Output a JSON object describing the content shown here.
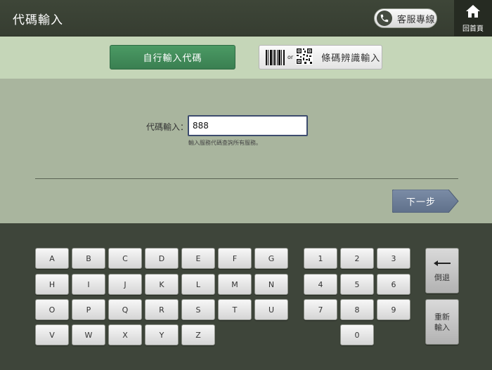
{
  "header": {
    "title": "代碼輸入",
    "hotline_label": "客服專線",
    "home_label": "回首頁"
  },
  "mode": {
    "manual_label": "自行輸入代碼",
    "or_text": "or",
    "scan_label": "條碼辨識輸入"
  },
  "form": {
    "code_label": "代碼輸入：",
    "code_value": "888",
    "hint": "輸入服務代碼查詢所有服務。",
    "next_label": "下一步"
  },
  "keyboard": {
    "letters": [
      "A",
      "B",
      "C",
      "D",
      "E",
      "F",
      "G",
      "H",
      "I",
      "J",
      "K",
      "L",
      "M",
      "N",
      "O",
      "P",
      "Q",
      "R",
      "S",
      "T",
      "U",
      "V",
      "W",
      "X",
      "Y",
      "Z"
    ],
    "digits": [
      "1",
      "2",
      "3",
      "4",
      "5",
      "6",
      "7",
      "8",
      "9",
      "0"
    ],
    "backspace_label": "倒退",
    "reset_line1": "重新",
    "reset_line2": "輸入"
  },
  "colors": {
    "header_bg": "#3e4638",
    "mode_bar_bg": "#c5d6b8",
    "panel_bg": "#a9b59e",
    "keyboard_bg": "#3e453a",
    "active_mode_green": "#3f8a57",
    "next_button_blue": "#6b7c96"
  },
  "icons": {
    "hotline": "phone-icon",
    "home": "home-icon",
    "scan": "barcode-qr-icon",
    "backspace": "arrow-left-icon"
  }
}
